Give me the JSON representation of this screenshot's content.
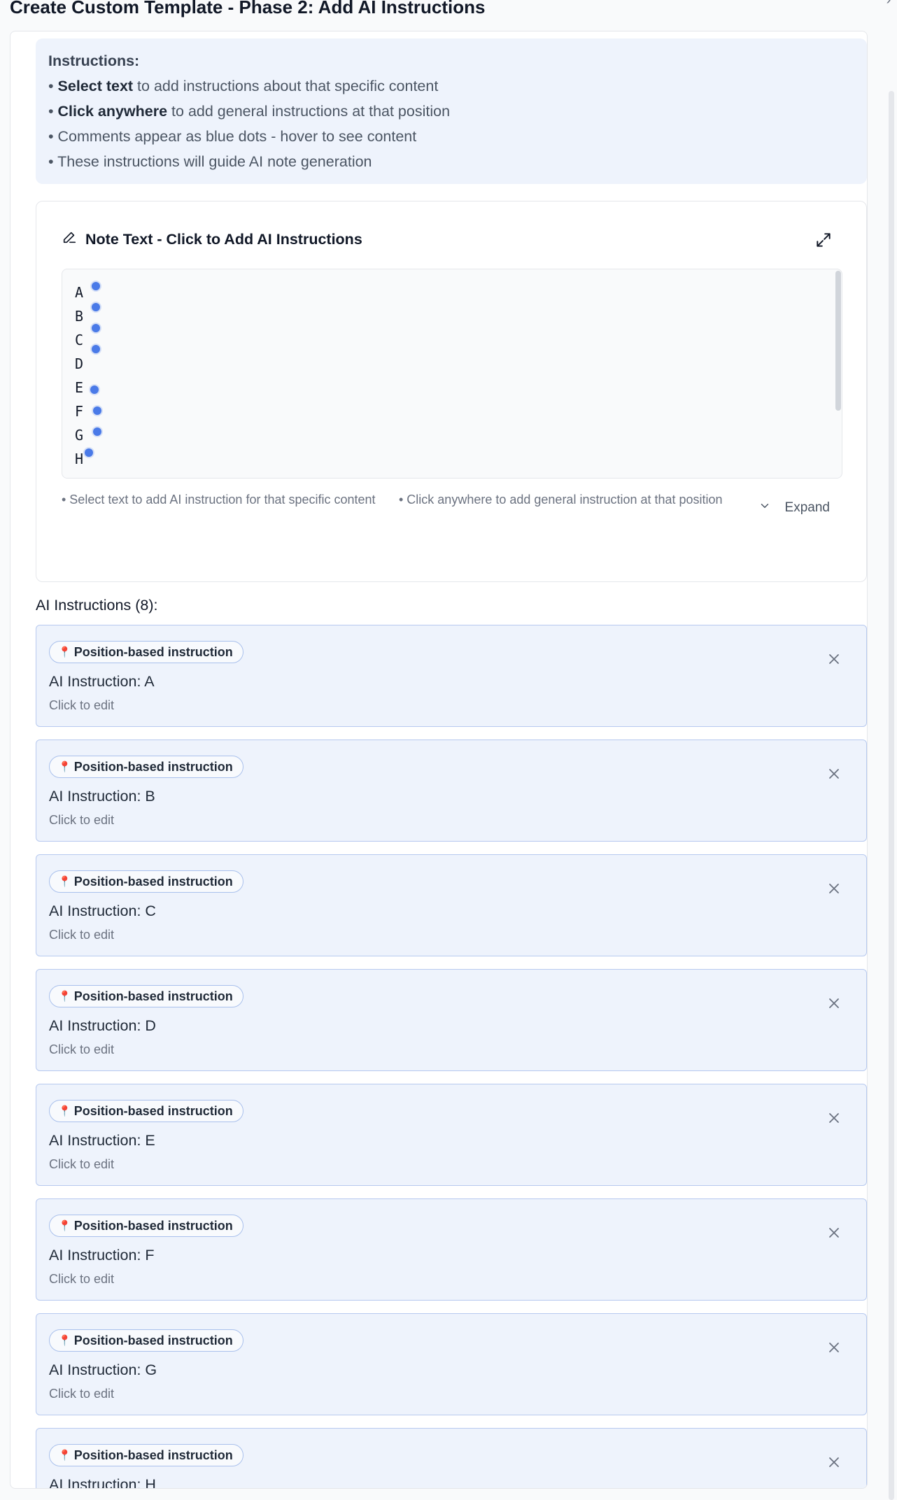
{
  "dialog": {
    "title": "Create Custom Template - Phase 2: Add AI Instructions",
    "close_glyph": "›"
  },
  "info": {
    "title": "Instructions:",
    "lines": [
      {
        "bold": "Select text",
        "rest": " to add instructions about that specific content"
      },
      {
        "bold": "Click anywhere",
        "rest": " to add general instructions at that position"
      },
      {
        "bold": "",
        "rest": "Comments appear as blue dots - hover to see content"
      },
      {
        "bold": "",
        "rest": "These instructions will guide AI note generation"
      }
    ]
  },
  "note": {
    "header": "Note Text - Click to Add AI Instructions",
    "lines": [
      "A",
      "B",
      "C",
      "D",
      "E",
      "F",
      "G",
      "H"
    ],
    "helper_left": "• Select text to add AI instruction for that specific content",
    "helper_right": "• Click anywhere to add general instruction at that position",
    "expand_label": "Expand"
  },
  "instructions": {
    "title": "AI Instructions (8):",
    "badge_label": "Position-based instruction",
    "badge_icon": "📍",
    "sub_label": "Click to edit",
    "items": [
      {
        "text": "AI Instruction: A"
      },
      {
        "text": "AI Instruction: B"
      },
      {
        "text": "AI Instruction: C"
      },
      {
        "text": "AI Instruction: D"
      },
      {
        "text": "AI Instruction: E"
      },
      {
        "text": "AI Instruction: F"
      },
      {
        "text": "AI Instruction: G"
      },
      {
        "text": "AI Instruction: H"
      }
    ]
  },
  "colors": {
    "accent_dot": "#4a7ae8",
    "card_bg": "#eef3fc",
    "card_border": "#b7c9ef"
  }
}
